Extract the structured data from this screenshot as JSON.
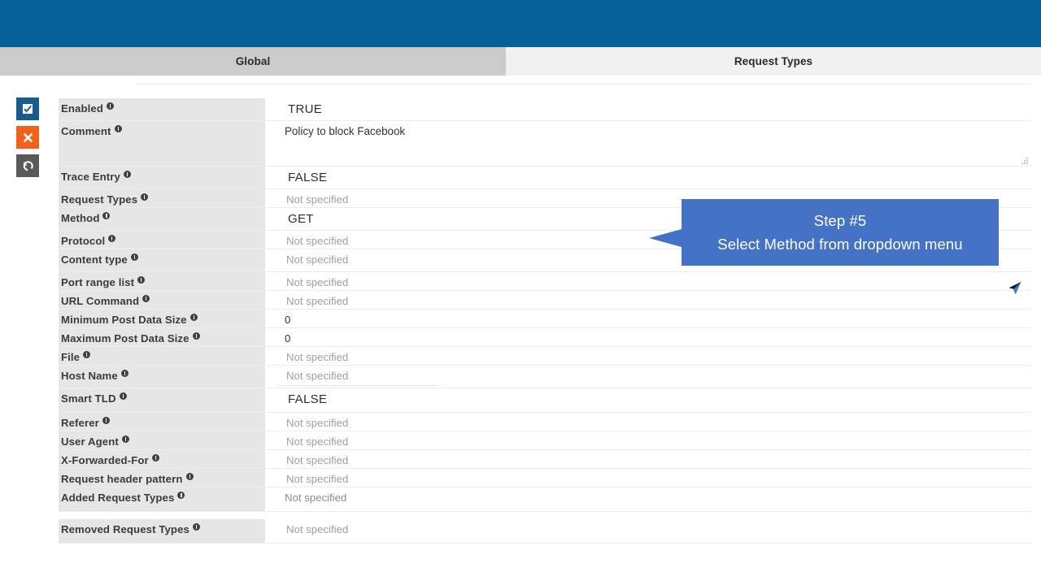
{
  "header": {
    "bar_color": "#06619b"
  },
  "tabs": [
    {
      "label": "Global",
      "active": true
    },
    {
      "label": "Request Types",
      "active": false
    }
  ],
  "actions": [
    {
      "name": "apply",
      "icon": "checkbox-icon",
      "color": "#175b8f"
    },
    {
      "name": "cancel",
      "icon": "close-x-icon",
      "color": "#f4601a"
    },
    {
      "name": "undo",
      "icon": "undo-arrow-icon",
      "color": "#595959"
    }
  ],
  "placeholder_text": "Not specified",
  "fields": [
    {
      "label": "Enabled",
      "value": "TRUE",
      "style": "strong"
    },
    {
      "label": "Comment",
      "value": "Policy to block Facebook",
      "style": "comment"
    },
    {
      "label": "Trace Entry",
      "value": "FALSE",
      "style": "strong"
    },
    {
      "label": "Request Types",
      "value": "Not specified",
      "style": "placeholder"
    },
    {
      "label": "Method",
      "value": "GET",
      "style": "strong"
    },
    {
      "label": "Protocol",
      "value": "Not specified",
      "style": "placeholder"
    },
    {
      "label": "Content type",
      "value": "Not specified",
      "style": "placeholder"
    },
    {
      "label": "Port range list",
      "value": "Not specified",
      "style": "placeholder"
    },
    {
      "label": "URL Command",
      "value": "Not specified",
      "style": "placeholder"
    },
    {
      "label": "Minimum Post Data Size",
      "value": "0",
      "style": "plain"
    },
    {
      "label": "Maximum Post Data Size",
      "value": "0",
      "style": "plain"
    },
    {
      "label": "File",
      "value": "Not specified",
      "style": "placeholder"
    },
    {
      "label": "Host Name",
      "value": "Not specified",
      "style": "input"
    },
    {
      "label": "Smart TLD",
      "value": "FALSE",
      "style": "strong"
    },
    {
      "label": "Referer",
      "value": "Not specified",
      "style": "placeholder"
    },
    {
      "label": "User Agent",
      "value": "Not specified",
      "style": "placeholder"
    },
    {
      "label": "X-Forwarded-For",
      "value": "Not specified",
      "style": "placeholder"
    },
    {
      "label": "Request header pattern",
      "value": "Not specified",
      "style": "placeholder"
    },
    {
      "label": "Added Request Types",
      "value": "Not specified",
      "style": "multi"
    },
    {
      "label": "Removed Request Types",
      "value": "Not specified",
      "style": "multi"
    }
  ],
  "callout": {
    "line1": "Step #5",
    "line2": "Select Method from dropdown menu",
    "color": "#4472c4"
  }
}
